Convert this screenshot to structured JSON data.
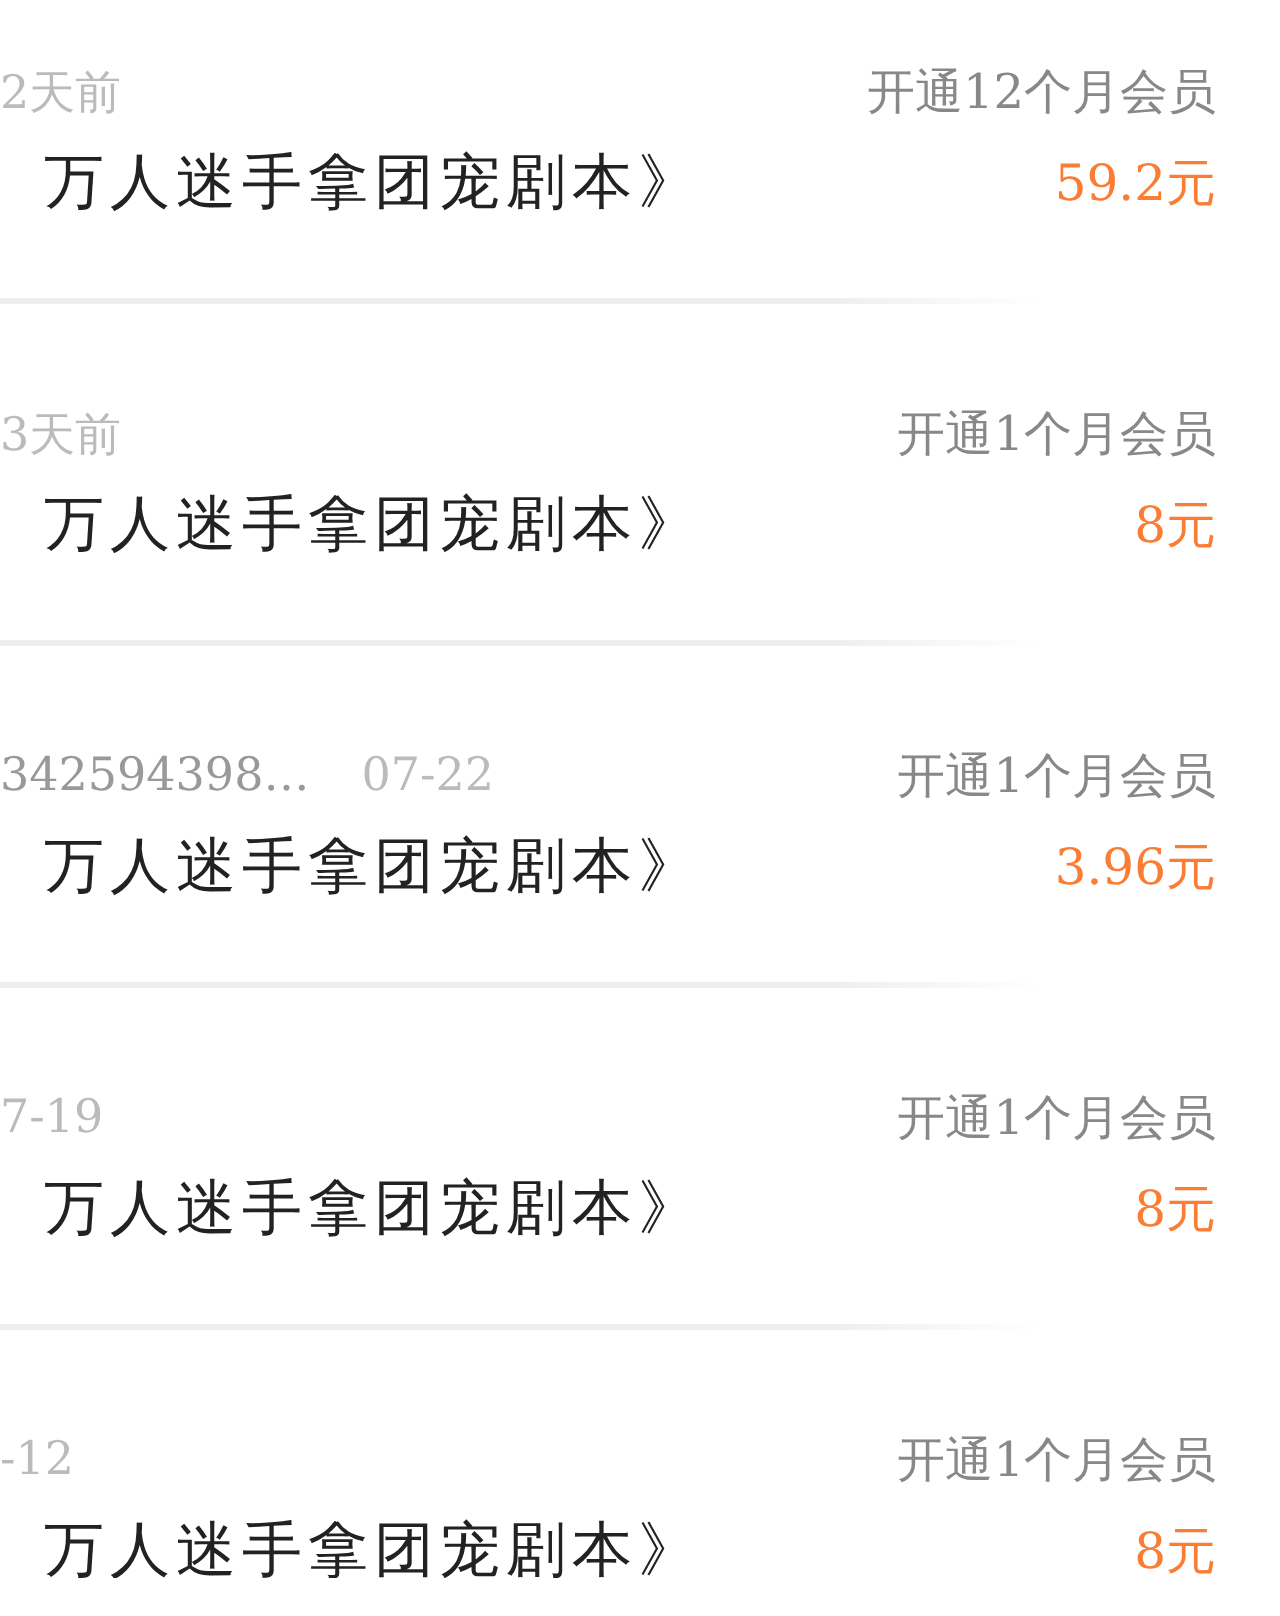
{
  "orders": [
    {
      "date": "2天前",
      "title": "万人迷手拿团宠剧本》",
      "plan": "开通12个月会员",
      "price": "59.2元"
    },
    {
      "date": "3天前",
      "title": "万人迷手拿团宠剧本》",
      "plan": "开通1个月会员",
      "price": "8元"
    },
    {
      "user": "342594398…",
      "date": "07-22",
      "title": "万人迷手拿团宠剧本》",
      "plan": "开通1个月会员",
      "price": "3.96元"
    },
    {
      "date": "7-19",
      "title": "万人迷手拿团宠剧本》",
      "plan": "开通1个月会员",
      "price": "8元"
    },
    {
      "date": "-12",
      "title": "万人迷手拿团宠剧本》",
      "plan": "开通1个月会员",
      "price": "8元"
    }
  ]
}
